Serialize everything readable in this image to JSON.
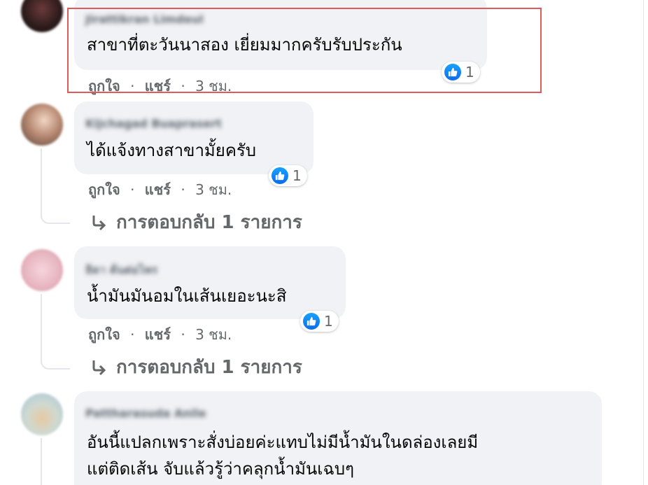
{
  "comments": [
    {
      "author": "Jirattikran Limdeul",
      "text_lines": [
        "สาขาที่ตะวันนาสอง เยี่ยมมากครับรับประกัน"
      ],
      "reaction_count": "1",
      "like_label": "ถูกใจ",
      "share_label": "แชร์",
      "time": "3 ชม."
    },
    {
      "author": "Kijchagad Buaprasert",
      "text_lines": [
        "ได้แจ้งทางสาขามั้ยครับ"
      ],
      "reaction_count": "1",
      "like_label": "ถูกใจ",
      "share_label": "แชร์",
      "time": "3 ชม.",
      "replies_label": "การตอบกลับ 1 รายการ"
    },
    {
      "author": "ธิดา ต้นต่อไพร",
      "text_lines": [
        "น้ำมันมันอมในเส้นเยอะนะสิ"
      ],
      "reaction_count": "1",
      "like_label": "ถูกใจ",
      "share_label": "แชร์",
      "time": "3 ชม.",
      "replies_label": "การตอบกลับ 1 รายการ"
    },
    {
      "author": "Pattharasuda Anile",
      "text_lines": [
        "อันนี้แปลกเพราะสั่งบ่อยค่ะแทบไม่มีน้ำมันในดล่องเลยมี",
        "แต่ติดเส้น จับแล้วรู้ว่าคลุกน้ำมันเฉบๆ"
      ]
    }
  ],
  "separator": "·",
  "icons": {
    "like": "like-icon",
    "reply_arrow": "reply-arrow-icon"
  },
  "colors": {
    "bubble": "#f0f2f5",
    "like_blue": "#1877f2",
    "meta_gray": "#65676b",
    "highlight_red": "#e05a5a"
  }
}
